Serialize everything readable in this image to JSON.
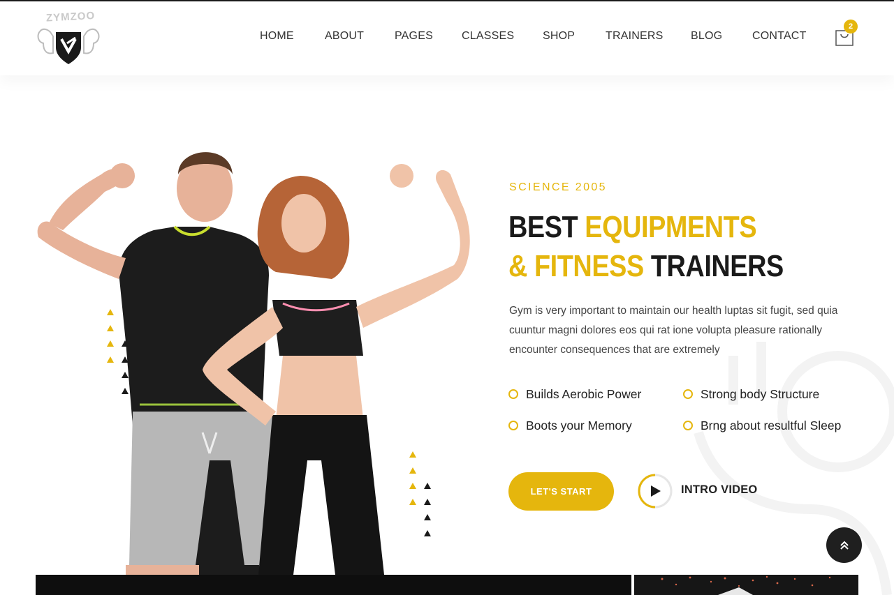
{
  "brand": {
    "logo_text": "ZYMZOO"
  },
  "nav": {
    "items": [
      {
        "label": "HOME"
      },
      {
        "label": "ABOUT"
      },
      {
        "label": "PAGES"
      },
      {
        "label": "CLASSES"
      },
      {
        "label": "SHOP"
      },
      {
        "label": "TRAINERS"
      },
      {
        "label": "BLOG"
      },
      {
        "label": "CONTACT"
      }
    ]
  },
  "cart": {
    "count": "2",
    "icon": "shopping-bag-icon"
  },
  "hero": {
    "eyebrow": "SCIENCE 2005",
    "headline": {
      "line1_dark": "BEST ",
      "line1_accent": "EQUIPMENTS",
      "line2_accent": "& FITNESS ",
      "line2_dark": "TRAINERS"
    },
    "description": "Gym is very important to maintain our health luptas sit fugit, sed quia cuuntur magni dolores eos qui rat ione volupta pleasure rationally encounter consequences that are extremely",
    "features": [
      {
        "label": "Builds Aerobic Power"
      },
      {
        "label": "Strong body Structure"
      },
      {
        "label": "Boots your Memory"
      },
      {
        "label": "Brng about resultful Sleep"
      }
    ],
    "cta_label": "LET'S START",
    "video_label": "INTRO VIDEO"
  },
  "colors": {
    "accent": "#e5b60d",
    "dark": "#1a1a1a"
  }
}
